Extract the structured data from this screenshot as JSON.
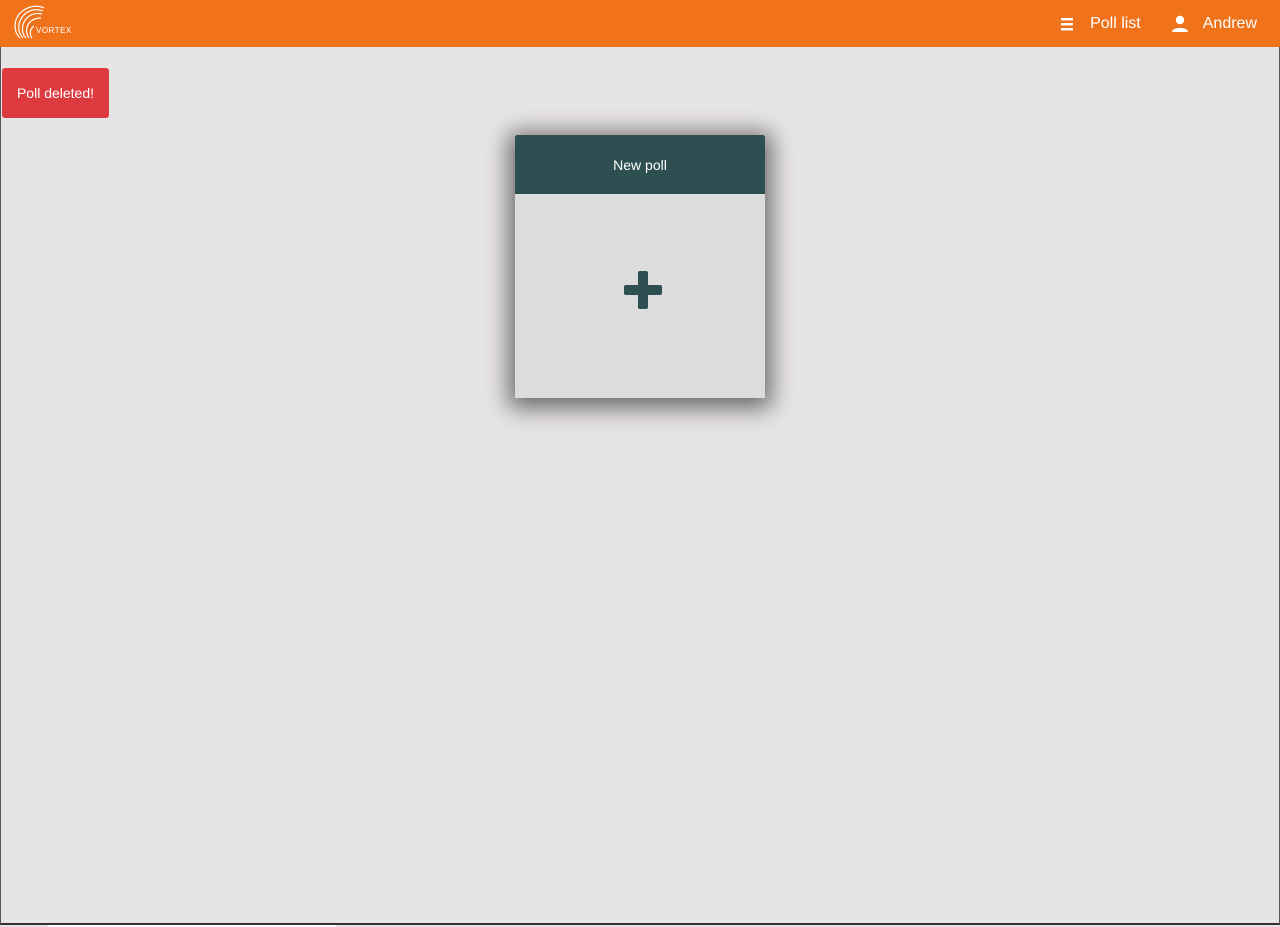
{
  "app": {
    "logo_text": "VORTEX"
  },
  "navbar": {
    "background": "#f0731c",
    "poll_list_label": "Poll list",
    "poll_list_icon": "hamburger-icon",
    "user_name": "Andrew",
    "user_icon": "user-icon"
  },
  "toast": {
    "message": "Poll deleted!",
    "color": "#dc3a3f"
  },
  "new_poll_card": {
    "title": "New poll",
    "icon": "plus-icon",
    "header_color": "#2e4f51"
  }
}
